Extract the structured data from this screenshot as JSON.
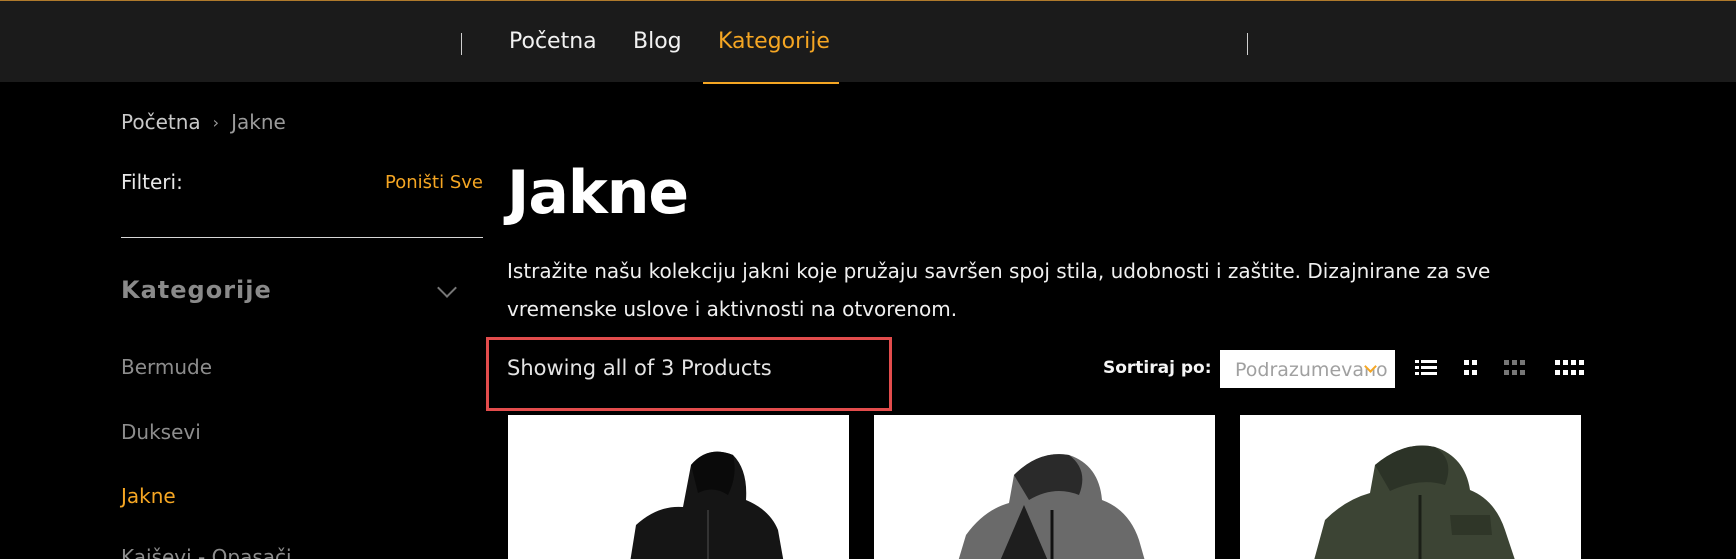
{
  "nav": {
    "items": [
      {
        "label": "Početna",
        "active": false
      },
      {
        "label": "Blog",
        "active": false
      },
      {
        "label": "Kategorije",
        "active": true
      }
    ]
  },
  "breadcrumb": {
    "home": "Početna",
    "separator": "›",
    "current": "Jakne"
  },
  "sidebar": {
    "filters_label": "Filteri:",
    "reset_label": "Poništi Sve",
    "category_heading": "Kategorije",
    "categories": [
      {
        "label": "Bermude",
        "active": false
      },
      {
        "label": "Duksevi",
        "active": false
      },
      {
        "label": "Jakne",
        "active": true
      },
      {
        "label": "Kaiševi - Opasači",
        "active": false
      }
    ]
  },
  "main": {
    "title": "Jakne",
    "description": "Istražite našu kolekciju jakni koje pružaju savršen spoj stila, udobnosti i zaštite. Dizajnirane za sve vremenske uslove i aktivnosti na otvorenom.",
    "showing": "Showing all of 3 Products",
    "sort_label": "Sortiraj po:",
    "sort_value": "Podrazumevano",
    "view_icons": [
      "list-view-icon",
      "grid-2-icon",
      "grid-3-icon",
      "grid-4-icon"
    ]
  },
  "products": [
    {
      "image": "jacket-black-icon",
      "color": "#151515"
    },
    {
      "image": "jacket-grey-black-icon",
      "color": "#2b2b2b"
    },
    {
      "image": "jacket-olive-icon",
      "color": "#3c4434"
    }
  ],
  "colors": {
    "accent": "#f5a623",
    "highlight_box": "#e34c4c",
    "nav_bg": "#1b1b1b",
    "page_bg": "#000000"
  }
}
